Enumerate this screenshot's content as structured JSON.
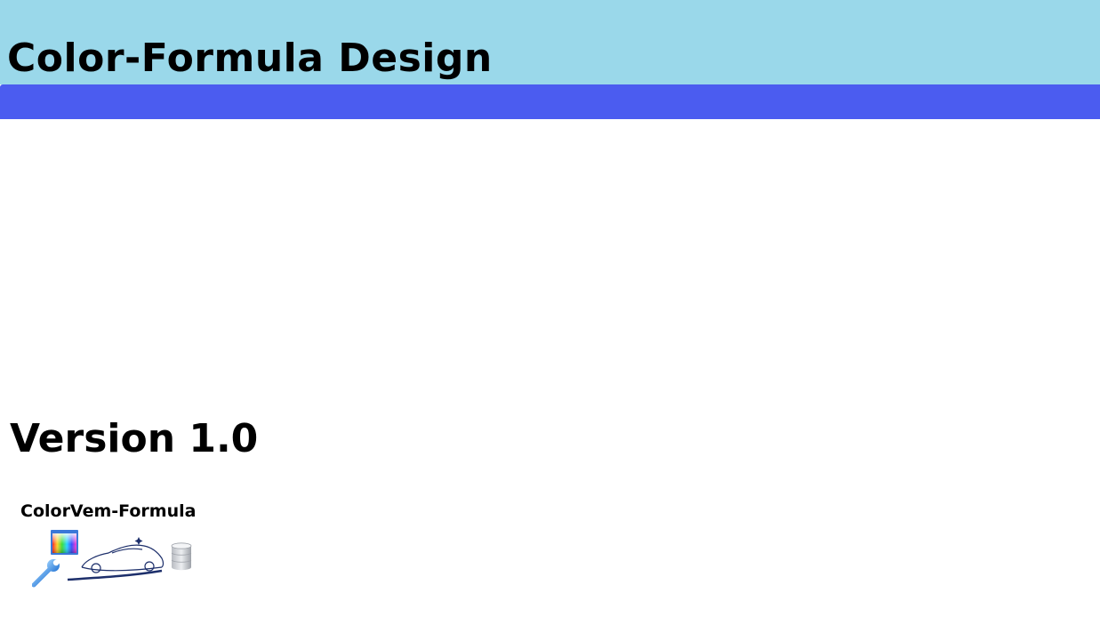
{
  "header": {
    "title": "Color-Formula Design"
  },
  "main": {
    "version": "Version 1.0"
  },
  "launcher": {
    "label": "ColorVem-Formula",
    "icons": [
      "color-palette-icon",
      "wrench-icon",
      "car-icon",
      "database-icon"
    ]
  },
  "colors": {
    "header_bg": "#9ad8ea",
    "nav_bar": "#4b5cf0",
    "page_bg": "#ffffff"
  }
}
